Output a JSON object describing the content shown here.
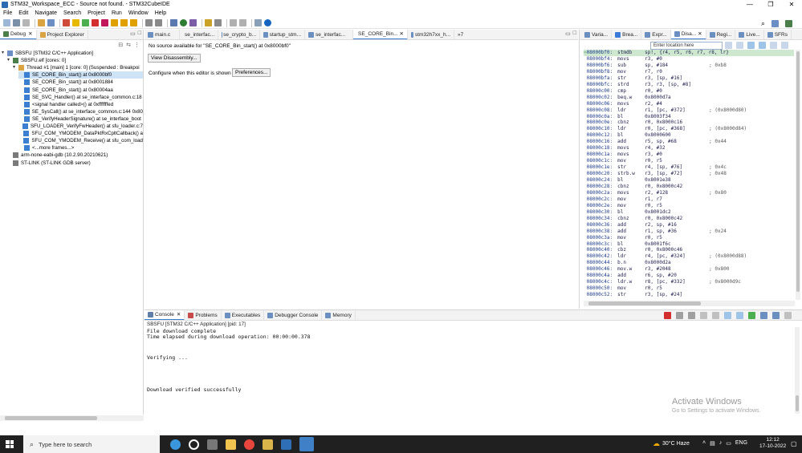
{
  "window": {
    "title": "STM32_Workspace_ECC - Source not found. - STM32CubeIDE",
    "controls": [
      "—",
      "❐",
      "✕"
    ]
  },
  "menu": [
    "File",
    "Edit",
    "Navigate",
    "Search",
    "Project",
    "Run",
    "Window",
    "Help"
  ],
  "debug_panel": {
    "tabs": [
      "Debug",
      "Project Explorer"
    ],
    "tree": [
      {
        "label": "SBSFU [STM32 C/C++ Application]",
        "level": 0,
        "twisty": "▾",
        "icon": "app",
        "selected": false
      },
      {
        "label": "SBSFU.elf [cores: 0]",
        "level": 1,
        "twisty": "▾",
        "icon": "elf",
        "selected": false
      },
      {
        "label": "Thread #1 [main] 1 [core: 0] (Suspended : Breakpoi",
        "level": 2,
        "twisty": "▾",
        "icon": "thread",
        "selected": false
      },
      {
        "label": "SE_CORE_Bin_start() at 0x8000bf0",
        "level": 3,
        "twisty": "",
        "icon": "frame",
        "selected": true
      },
      {
        "label": "SE_CORE_Bin_start() at 0x8001884",
        "level": 3,
        "twisty": "",
        "icon": "frame",
        "selected": false
      },
      {
        "label": "SE_CORE_Bin_start() at 0x80004aa",
        "level": 3,
        "twisty": "",
        "icon": "frame",
        "selected": false
      },
      {
        "label": "SE_SVC_Handler() at se_interface_common.c:18",
        "level": 3,
        "twisty": "",
        "icon": "frame",
        "selected": false
      },
      {
        "label": "<signal handler called>() at 0xfffffffed",
        "level": 3,
        "twisty": "",
        "icon": "frame",
        "selected": false
      },
      {
        "label": "SE_SysCall() at se_interface_common.c:144 0x80",
        "level": 3,
        "twisty": "",
        "icon": "frame",
        "selected": false
      },
      {
        "label": "SE_VerifyHeaderSignature() at se_interface_boot",
        "level": 3,
        "twisty": "",
        "icon": "frame",
        "selected": false
      },
      {
        "label": "SFU_LOADER_VerifyFwHeader() at sfu_loader.c:7",
        "level": 3,
        "twisty": "",
        "icon": "frame",
        "selected": false
      },
      {
        "label": "SFU_COM_YMODEM_DataPktRxCpltCallback() a",
        "level": 3,
        "twisty": "",
        "icon": "frame",
        "selected": false
      },
      {
        "label": "SFU_COM_YMODEM_Receive() at sfu_com_load",
        "level": 3,
        "twisty": "",
        "icon": "frame",
        "selected": false
      },
      {
        "label": "<...more frames...>",
        "level": 3,
        "twisty": "",
        "icon": "frame",
        "selected": false
      },
      {
        "label": "arm-none-eabi-gdb (10.2.90.20210621)",
        "level": 1,
        "twisty": "",
        "icon": "gdb",
        "selected": false
      },
      {
        "label": "ST-LINK (ST-LINK GDB server)",
        "level": 1,
        "twisty": "",
        "icon": "gdb",
        "selected": false
      }
    ]
  },
  "editor": {
    "tabs": [
      "main.c",
      "se_interfac...",
      "se_crypto_b...",
      "startup_stm...",
      "se_interfac...",
      "SE_CORE_Bin...",
      "stm32h7xx_h..."
    ],
    "overflow_count": "»7",
    "active_tab": 5,
    "message": "No source available for \"SE_CORE_Bin_start() at 0x8000bf0\"",
    "view_disassembly_label": "View Disassembly...",
    "configure_text": "Configure when this editor is shown",
    "preferences_label": "Preferences..."
  },
  "right_panel": {
    "tabs": [
      "Varia...",
      "Brea...",
      "Expr...",
      "Disa...",
      "Regi...",
      "Live...",
      "SFRs"
    ],
    "active_tab": 3,
    "location_placeholder": "Enter location here"
  },
  "disassembly": [
    {
      "addr": "08000bf0:",
      "op": "stmdb",
      "args": "sp!, {r4, r5, r6, r7, r8, lr}",
      "cm": "",
      "current": true
    },
    {
      "addr": "08000bf4:",
      "op": "movs",
      "args": "r3, #0",
      "cm": ""
    },
    {
      "addr": "08000bf6:",
      "op": "sub",
      "args": "sp, #184",
      "cm": "; 0xb8"
    },
    {
      "addr": "08000bf8:",
      "op": "mov",
      "args": "r7, r0",
      "cm": ""
    },
    {
      "addr": "08000bfa:",
      "op": "str",
      "args": "r3, [sp, #16]",
      "cm": ""
    },
    {
      "addr": "08000bfc:",
      "op": "strd",
      "args": "r3, r3, [sp, #8]",
      "cm": ""
    },
    {
      "addr": "08000c00:",
      "op": "cmp",
      "args": "r0, #0",
      "cm": ""
    },
    {
      "addr": "08000c02:",
      "op": "beq.w",
      "args": "0x8000d7a",
      "cm": ""
    },
    {
      "addr": "08000c06:",
      "op": "movs",
      "args": "r2, #4",
      "cm": ""
    },
    {
      "addr": "08000c08:",
      "op": "ldr",
      "args": "r1, [pc, #372]",
      "cm": "; (0x8000d80)"
    },
    {
      "addr": "08000c0a:",
      "op": "bl",
      "args": "0x8003f34",
      "cm": ""
    },
    {
      "addr": "08000c0e:",
      "op": "cbnz",
      "args": "r0, 0x8000c16",
      "cm": ""
    },
    {
      "addr": "08000c10:",
      "op": "ldr",
      "args": "r0, [pc, #368]",
      "cm": "; (0x8000d84)"
    },
    {
      "addr": "08000c12:",
      "op": "bl",
      "args": "0x8000600",
      "cm": ""
    },
    {
      "addr": "08000c16:",
      "op": "add",
      "args": "r5, sp, #68",
      "cm": "; 0x44"
    },
    {
      "addr": "08000c18:",
      "op": "movs",
      "args": "r4, #32",
      "cm": ""
    },
    {
      "addr": "08000c1a:",
      "op": "movs",
      "args": "r3, #0",
      "cm": ""
    },
    {
      "addr": "08000c1c:",
      "op": "mov",
      "args": "r0, r5",
      "cm": ""
    },
    {
      "addr": "08000c1e:",
      "op": "str",
      "args": "r4, [sp, #76]",
      "cm": "; 0x4c"
    },
    {
      "addr": "08000c20:",
      "op": "strb.w",
      "args": "r3, [sp, #72]",
      "cm": "; 0x48"
    },
    {
      "addr": "08000c24:",
      "op": "bl",
      "args": "0x8001e38",
      "cm": ""
    },
    {
      "addr": "08000c28:",
      "op": "cbnz",
      "args": "r0, 0x8000c42",
      "cm": ""
    },
    {
      "addr": "08000c2a:",
      "op": "movs",
      "args": "r2, #128",
      "cm": "; 0x80"
    },
    {
      "addr": "08000c2c:",
      "op": "mov",
      "args": "r1, r7",
      "cm": ""
    },
    {
      "addr": "08000c2e:",
      "op": "mov",
      "args": "r0, r5",
      "cm": ""
    },
    {
      "addr": "08000c30:",
      "op": "bl",
      "args": "0x8001dc2",
      "cm": ""
    },
    {
      "addr": "08000c34:",
      "op": "cbnz",
      "args": "r0, 0x8000c42",
      "cm": ""
    },
    {
      "addr": "08000c36:",
      "op": "add",
      "args": "r2, sp, #16",
      "cm": ""
    },
    {
      "addr": "08000c38:",
      "op": "add",
      "args": "r1, sp, #36",
      "cm": "; 0x24"
    },
    {
      "addr": "08000c3a:",
      "op": "mov",
      "args": "r0, r5",
      "cm": ""
    },
    {
      "addr": "08000c3c:",
      "op": "bl",
      "args": "0x8001f6c",
      "cm": ""
    },
    {
      "addr": "08000c40:",
      "op": "cbz",
      "args": "r0, 0x8000c46",
      "cm": ""
    },
    {
      "addr": "08000c42:",
      "op": "ldr",
      "args": "r4, [pc, #324]",
      "cm": "; (0x8000d88)"
    },
    {
      "addr": "08000c44:",
      "op": "b.n",
      "args": "0x8000d2a",
      "cm": ""
    },
    {
      "addr": "08000c46:",
      "op": "mov.w",
      "args": "r3, #2048",
      "cm": "; 0x800"
    },
    {
      "addr": "08000c4a:",
      "op": "add",
      "args": "r6, sp, #20",
      "cm": ""
    },
    {
      "addr": "08000c4c:",
      "op": "ldr.w",
      "args": "r8, [pc, #332]",
      "cm": "; 0x8000d9c"
    },
    {
      "addr": "08000c50:",
      "op": "mov",
      "args": "r0, r5",
      "cm": ""
    },
    {
      "addr": "08000c52:",
      "op": "str",
      "args": "r3, [sp, #24]",
      "cm": ""
    }
  ],
  "console_panel": {
    "tabs": [
      "Console",
      "Problems",
      "Executables",
      "Debugger Console",
      "Memory"
    ],
    "header": "SBSFU [STM32 C/C++ Application]  [pid: 17]",
    "lines": [
      "File download complete",
      "Time elapsed during download operation: 00:00:00.378",
      "",
      "",
      "",
      "Verifying ...",
      "",
      "",
      "",
      "",
      "",
      "Download verified successfully"
    ]
  },
  "watermark": {
    "title": "Activate Windows",
    "subtitle": "Go to Settings to activate Windows."
  },
  "taskbar": {
    "search_placeholder": "Type here to search",
    "weather": "30°C  Haze",
    "lang": "ENG",
    "time": "12:12",
    "date": "17-10-2022",
    "apps": [
      "files-icon",
      "task-view-icon",
      "explorer-icon",
      "chrome-icon",
      "note-icon",
      "prg-icon",
      "ide-icon"
    ]
  },
  "colors": {
    "accent": "#3c7fd1",
    "selection": "#cfe3f7",
    "current_line": "#cde8cf",
    "taskbar": "#202020"
  }
}
